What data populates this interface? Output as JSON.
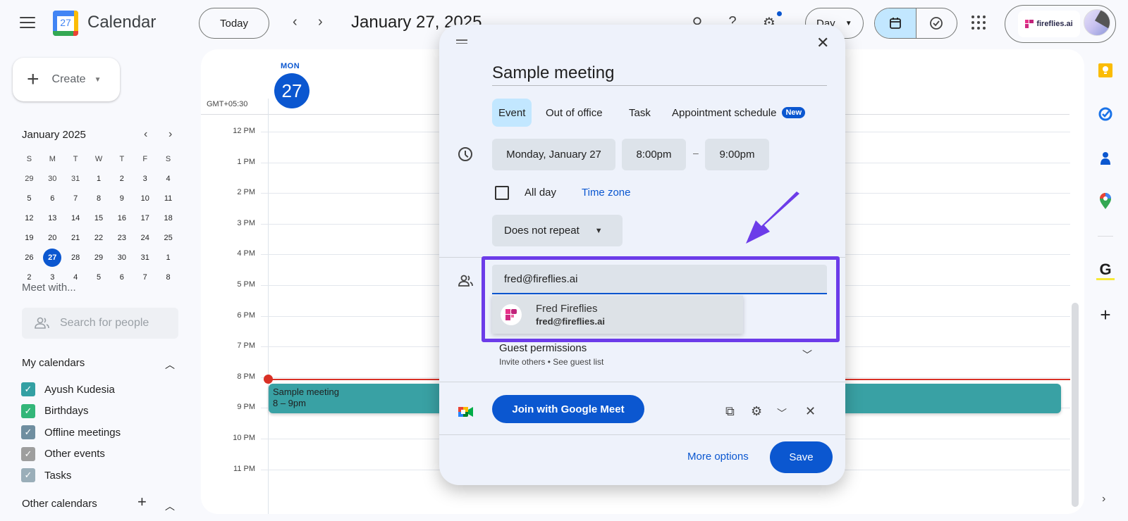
{
  "header": {
    "app_title": "Calendar",
    "logo_day": "27",
    "today_label": "Today",
    "date_title": "January 27, 2025",
    "view_select": "Day",
    "account_brand": "fireflies.ai"
  },
  "sidebar": {
    "create_label": "Create",
    "mini_calendar": {
      "title": "January 2025",
      "weekdays": [
        "S",
        "M",
        "T",
        "W",
        "T",
        "F",
        "S"
      ],
      "weeks": [
        [
          "29",
          "30",
          "31",
          "1",
          "2",
          "3",
          "4"
        ],
        [
          "5",
          "6",
          "7",
          "8",
          "9",
          "10",
          "11"
        ],
        [
          "12",
          "13",
          "14",
          "15",
          "16",
          "17",
          "18"
        ],
        [
          "19",
          "20",
          "21",
          "22",
          "23",
          "24",
          "25"
        ],
        [
          "26",
          "27",
          "28",
          "29",
          "30",
          "31",
          "1"
        ],
        [
          "2",
          "3",
          "4",
          "5",
          "6",
          "7",
          "8"
        ]
      ],
      "selected": "27"
    },
    "meet_with": "Meet with...",
    "search_people_placeholder": "Search for people",
    "my_calendars_title": "My calendars",
    "my_calendars": [
      {
        "label": "Ayush Kudesia",
        "color": "#33a0a3"
      },
      {
        "label": "Birthdays",
        "color": "#33b679"
      },
      {
        "label": "Offline meetings",
        "color": "#6f8ea0"
      },
      {
        "label": "Other events",
        "color": "#9e9e9e"
      },
      {
        "label": "Tasks",
        "color": "#9aaeb9"
      }
    ],
    "other_calendars_title": "Other calendars"
  },
  "day_view": {
    "day_name": "MON",
    "day_number": "27",
    "timezone": "GMT+05:30",
    "hours": [
      "12 PM",
      "1 PM",
      "2 PM",
      "3 PM",
      "4 PM",
      "5 PM",
      "6 PM",
      "7 PM",
      "8 PM",
      "9 PM",
      "10 PM",
      "11 PM"
    ],
    "event": {
      "title": "Sample meeting",
      "time": "8 – 9pm",
      "color": "#39a1a4"
    }
  },
  "dialog": {
    "title_value": "Sample meeting",
    "tabs": [
      "Event",
      "Out of office",
      "Task",
      "Appointment schedule"
    ],
    "new_badge": "New",
    "date": "Monday, January 27",
    "start_time": "8:00pm",
    "end_time": "9:00pm",
    "dash": "–",
    "all_day_label": "All day",
    "time_zone_link": "Time zone",
    "repeat": "Does not repeat",
    "guest_input_value": "fred@fireflies.ai",
    "suggestion": {
      "name": "Fred Fireflies",
      "email": "fred@fireflies.ai"
    },
    "guest_permissions_title": "Guest permissions",
    "guest_permissions_sub": "Invite others • See guest list",
    "meet_button": "Join with Google Meet",
    "more_options": "More options",
    "save": "Save"
  },
  "colors": {
    "accent": "#0b57d0",
    "highlight": "#6c3ce9",
    "now_line": "#d93025"
  }
}
